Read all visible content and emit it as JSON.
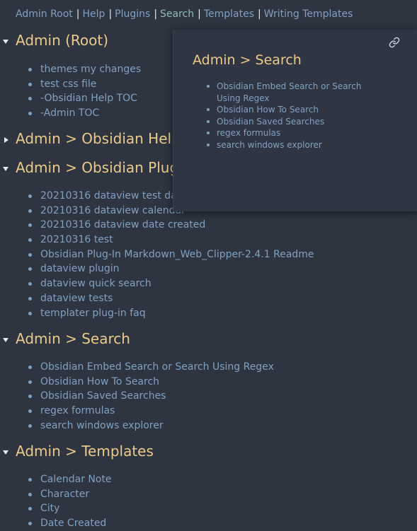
{
  "breadcrumb": [
    {
      "label": "Admin Root"
    },
    {
      "label": "Help"
    },
    {
      "label": "Plugins"
    },
    {
      "label": "Search"
    },
    {
      "label": "Templates"
    },
    {
      "label": "Writing Templates"
    }
  ],
  "sections": [
    {
      "title": "Admin (Root)",
      "items": [
        "themes my changes",
        "test css file",
        "-Obsidian Help TOC",
        "-Admin TOC"
      ]
    },
    {
      "title": "Admin > Obsidian Help",
      "items": []
    },
    {
      "title": "Admin > Obsidian Plug",
      "items": [
        "20210316 dataview test date",
        "20210316 dataview calendar",
        "20210316 dataview date created",
        "20210316 test",
        "Obsidian Plug-In Markdown_Web_Clipper-2.4.1 Readme",
        "dataview plugin",
        "dataview quick search",
        "dataview tests",
        "templater plug-in faq"
      ]
    },
    {
      "title": "Admin > Search",
      "items": [
        "Obsidian Embed Search or Search Using Regex",
        "Obsidian How To Search",
        "Obsidian Saved Searches",
        "regex formulas",
        "search windows explorer"
      ]
    },
    {
      "title": "Admin > Templates",
      "items": [
        "Calendar Note",
        "Character",
        "City",
        "Date Created"
      ]
    }
  ],
  "popover": {
    "title": "Admin > Search",
    "items": [
      "Obsidian Embed Search or Search Using Regex",
      "Obsidian How To Search",
      "Obsidian Saved Searches",
      "regex formulas",
      "search windows explorer"
    ],
    "icon": "link-icon"
  },
  "colors": {
    "background": "#2e3440",
    "heading": "#ebcb8b",
    "link": "#81a1c1",
    "popover_bg": "#2f3542"
  }
}
